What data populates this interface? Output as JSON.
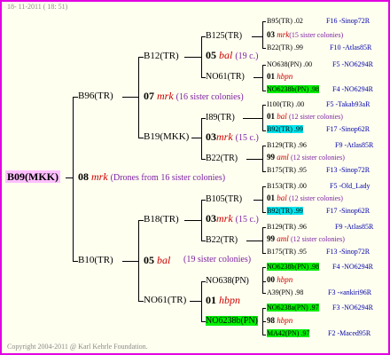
{
  "date": "18- 11-2011 ( 18: 51)",
  "copyright": "Copyright 2004-2011 @ Karl Kehrle Foundation.",
  "root": {
    "id": "B09(MKK)",
    "num": "08",
    "mark": "mrk",
    "note": "(Drones from 16 sister colonies)"
  },
  "gen1": [
    {
      "id": "B96(TR)"
    },
    {
      "id": "B10(TR)"
    }
  ],
  "gen1_drones": [
    {
      "num": "07",
      "mark": "mrk",
      "note": "(16 sister colonies)"
    },
    {
      "num": "05",
      "mark": "bal",
      "note": "(19 sister colonies)"
    }
  ],
  "gen2": [
    {
      "id": "B12(TR)"
    },
    {
      "id": "B19(MKK)"
    },
    {
      "id": "B18(TR)"
    },
    {
      "id": "NO61(TR)"
    }
  ],
  "gen2_drones": [
    {
      "num": "05",
      "mark": "bal",
      "note": "(19 c.)"
    },
    {
      "num": "03",
      "mark": "mrk",
      "note": "(15 c.)"
    },
    {
      "num": "03",
      "mark": "mrk",
      "note": "(15 c.)"
    },
    {
      "num": "01",
      "mark": "hbpn",
      "note": ""
    }
  ],
  "gen3": [
    {
      "id": "B125(TR)"
    },
    {
      "id": "NO61(TR)"
    },
    {
      "id": "I89(TR)"
    },
    {
      "id": "B22(TR)"
    },
    {
      "id": "B105(TR)"
    },
    {
      "id": "B22(TR)"
    },
    {
      "id": "NO638(PN)"
    },
    {
      "id": "NO6238b(PN)"
    }
  ],
  "gen4": [
    {
      "a": "B95(TR) .02",
      "a_code": "F16 -Sinop72R",
      "num": "03",
      "mark": "mrk",
      "note": "(15 sister colonies)",
      "b": "B22(TR) .99",
      "b_code": "F10 -Atlas85R"
    },
    {
      "a": "NO638(PN) .00",
      "a_code": "F5 -NO6294R",
      "num": "01",
      "mark": "hbpn",
      "note": "",
      "b": "NO6238b(PN) .98",
      "b_code": "F4 -NO6294R"
    },
    {
      "a": "I100(TR) .00",
      "a_code": "F5 -Takab93aR",
      "num": "01",
      "mark": "bal",
      "note": "(12 sister colonies)",
      "b": "B92(TR) .99",
      "b_code": "F17 -Sinop62R"
    },
    {
      "a": "B129(TR) .96",
      "a_code": "F9 -Atlas85R",
      "num": "99",
      "mark": "aml",
      "note": "(12 sister colonies)",
      "b": "B175(TR) .95",
      "b_code": "F13 -Sinop72R"
    },
    {
      "a": "B153(TR) .00",
      "a_code": "F5 -Old_Lady",
      "num": "01",
      "mark": "bal",
      "note": "(12 sister colonies)",
      "b": "B92(TR) .99",
      "b_code": "F17 -Sinop62R"
    },
    {
      "a": "B129(TR) .96",
      "a_code": "F9 -Atlas85R",
      "num": "99",
      "mark": "aml",
      "note": "(12 sister colonies)",
      "b": "B175(TR) .95",
      "b_code": "F13 -Sinop72R"
    },
    {
      "a": "NO6238b(PN) .98",
      "a_code": "F4 -NO6294R",
      "num": "00",
      "mark": "hbpn",
      "note": "",
      "b": "A39(PN) .98",
      "b_code": "F3 -«ankiri96R"
    },
    {
      "a": "NO6238a(PN) .97",
      "a_code": "F3 -NO6294R",
      "num": "98",
      "mark": "hbpn",
      "note": "",
      "b": "MA42(PN) .97",
      "b_code": "F2 -Maced95R"
    }
  ]
}
